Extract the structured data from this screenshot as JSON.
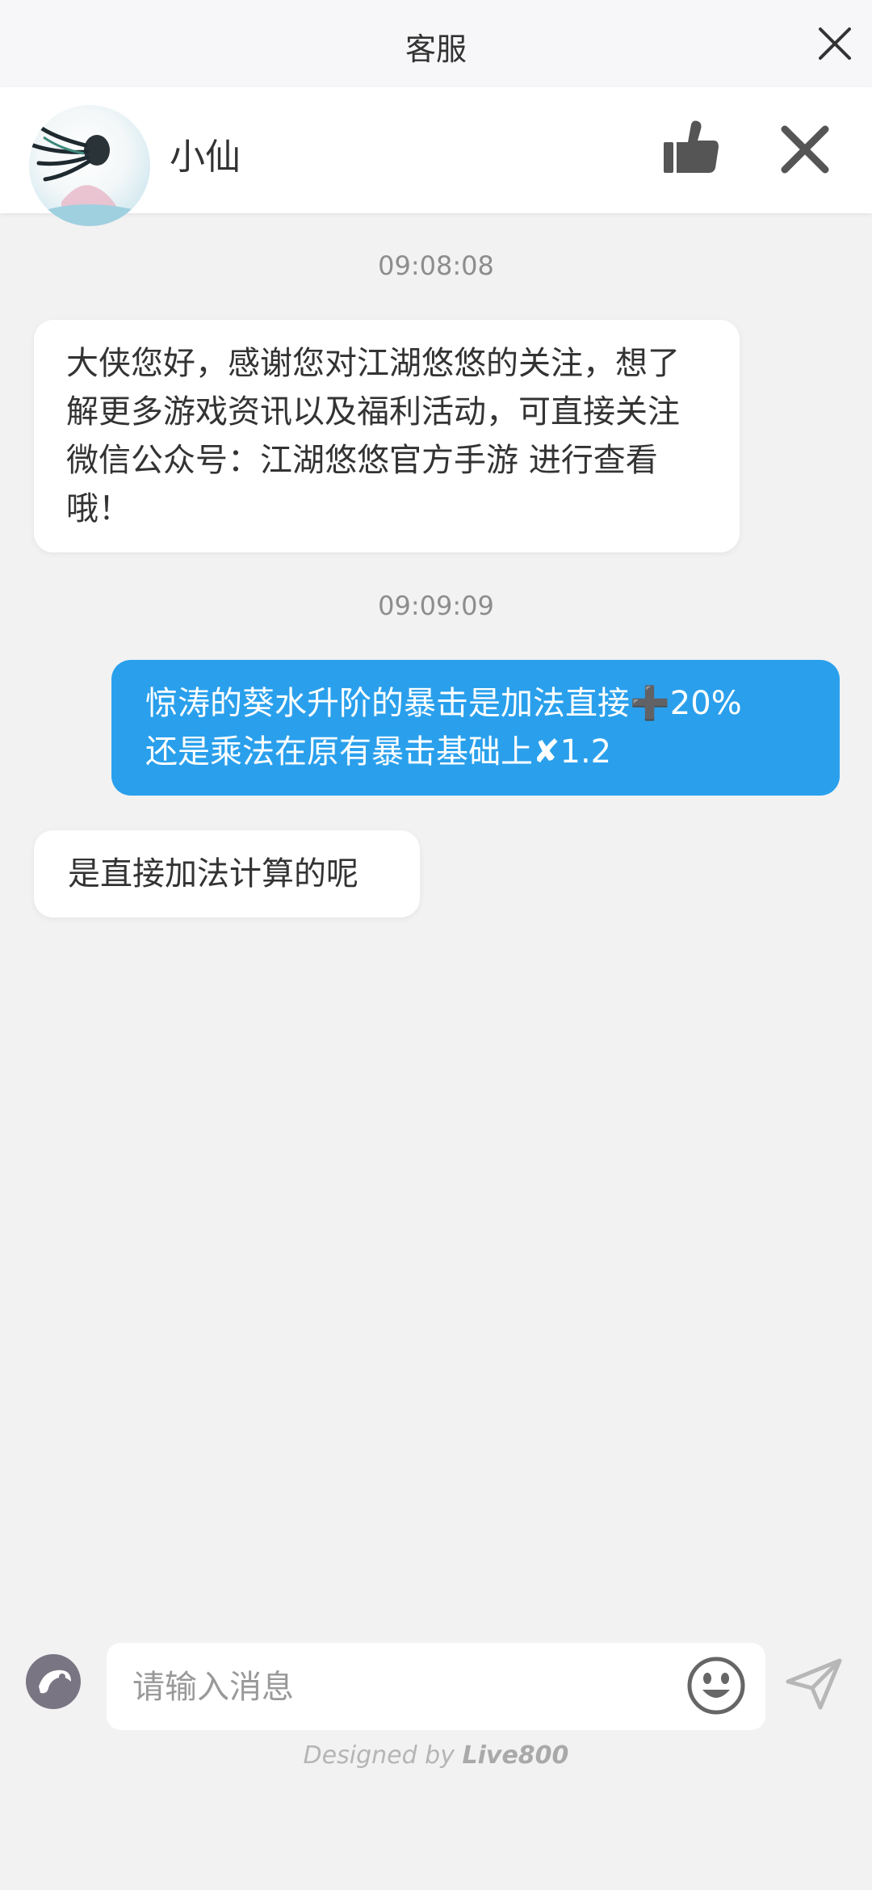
{
  "header": {
    "title": "客服"
  },
  "agent": {
    "name": "小仙"
  },
  "messages": [
    {
      "time": "09:08:08",
      "side": "in",
      "text": "大侠您好，感谢您对江湖悠悠的关注，想了解更多游戏资讯以及福利活动，可直接关注微信公众号：江湖悠悠官方手游 进行查看哦！"
    },
    {
      "time": "09:09:09",
      "side": "out",
      "text": "惊涛的葵水升阶的暴击是加法直接➕20%\n还是乘法在原有暴击基础上✘1.2"
    },
    {
      "side": "in",
      "text": "是直接加法计算的呢"
    }
  ],
  "composer": {
    "placeholder": "请输入消息"
  },
  "footer": {
    "prefix": "Designed by ",
    "brand": "Live800"
  },
  "colors": {
    "outgoing_bubble": "#2aa0ec",
    "background": "#f2f2f3"
  }
}
